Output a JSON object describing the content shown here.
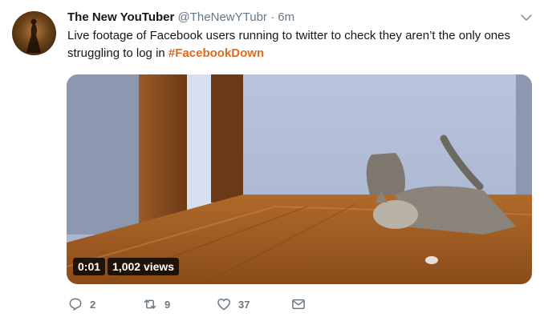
{
  "tweet": {
    "author": {
      "name": "The New YouTuber",
      "handle": "@TheNewYTubr",
      "separator": "·",
      "time": "6m"
    },
    "text_main": "Live footage of Facebook users running to twitter to check they aren’t the only ones struggling to log in ",
    "hashtag": "#FacebookDown",
    "video": {
      "duration": "0:01",
      "views": "1,002 views"
    },
    "actions": {
      "reply_count": "2",
      "retweet_count": "9",
      "like_count": "37"
    }
  },
  "icons": {
    "reply": "reply-icon",
    "retweet": "retweet-icon",
    "like": "heart-icon",
    "dm": "envelope-icon",
    "menu": "chevron-down-icon"
  },
  "colors": {
    "hashtag": "#e0691e",
    "muted": "#657786",
    "text": "#14171a"
  }
}
